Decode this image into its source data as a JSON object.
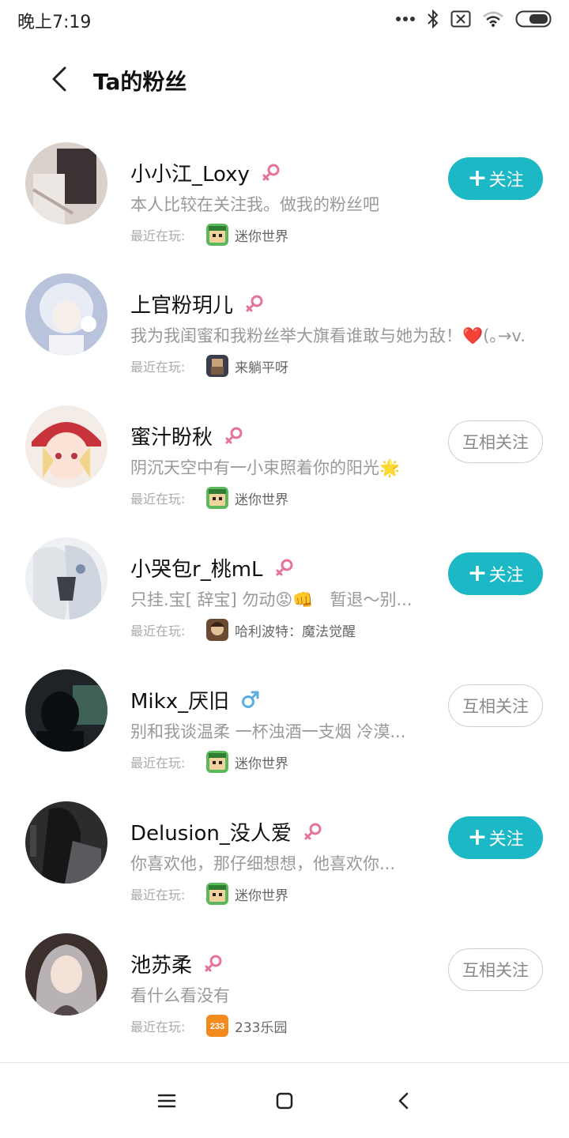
{
  "status_bar": {
    "time": "晚上7:19",
    "icons": [
      "more-dots-icon",
      "bluetooth-icon",
      "no-sim-icon",
      "wifi-icon",
      "battery-icon"
    ]
  },
  "header": {
    "title": "Ta的粉丝",
    "back_icon": "back-arrow-icon"
  },
  "colors": {
    "accent": "#1db8c6",
    "female": "#e5739a",
    "male": "#5aaee0"
  },
  "fans": [
    {
      "name": "小小江_Loxy",
      "gender": "female",
      "bio": "本人比较在关注我。做我的粉丝吧",
      "recent_label": "最近在玩:",
      "game": "迷你世界",
      "game_icon": "mini-world-icon",
      "action": "follow",
      "action_label": "关注"
    },
    {
      "name": "上官粉玥儿",
      "gender": "female",
      "bio": "我为我闺蜜和我粉丝举大旗看谁敢与她为敌！❤️(｡→v...",
      "recent_label": "最近在玩:",
      "game": "来躺平呀",
      "game_icon": "lie-flat-game-icon",
      "action": "none"
    },
    {
      "name": "蜜汁盼秋",
      "gender": "female",
      "bio": "阴沉天空中有一小束照着你的阳光🌟",
      "recent_label": "最近在玩:",
      "game": "迷你世界",
      "game_icon": "mini-world-icon",
      "action": "mutual",
      "action_label": "互相关注"
    },
    {
      "name": "小哭包r_桃mL",
      "gender": "female",
      "bio": "只挂.宝[ 辞宝] 勿动😡👊　暂退～别...",
      "recent_label": "最近在玩:",
      "game": "哈利波特：魔法觉醒",
      "game_icon": "harry-potter-game-icon",
      "action": "follow",
      "action_label": "关注"
    },
    {
      "name": "Mikx_厌旧",
      "gender": "male",
      "bio": "别和我谈温柔 一杯浊酒一支烟 冷漠...",
      "recent_label": "最近在玩:",
      "game": "迷你世界",
      "game_icon": "mini-world-icon",
      "action": "mutual",
      "action_label": "互相关注"
    },
    {
      "name": "Delusion_没人爱",
      "gender": "female",
      "bio": "你喜欢他，那仔细想想，他喜欢你...",
      "recent_label": "最近在玩:",
      "game": "迷你世界",
      "game_icon": "mini-world-icon",
      "action": "follow",
      "action_label": "关注"
    },
    {
      "name": "池苏柔",
      "gender": "female",
      "bio": "看什么看没有",
      "recent_label": "最近在玩:",
      "game": "233乐园",
      "game_icon": "233-park-icon",
      "game_icon_text": "233",
      "action": "mutual",
      "action_label": "互相关注"
    }
  ],
  "system_nav": {
    "icons": [
      "menu-icon",
      "home-square-icon",
      "back-chevron-icon"
    ]
  }
}
